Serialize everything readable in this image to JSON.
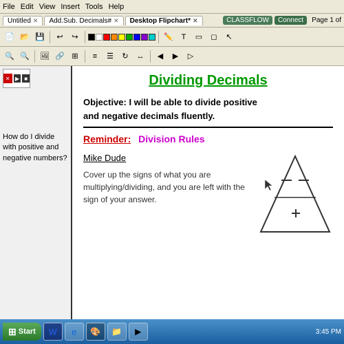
{
  "menubar": {
    "items": [
      "File",
      "Edit",
      "View",
      "Insert",
      "Tools",
      "Help"
    ]
  },
  "tabs": [
    {
      "label": "Untitled",
      "active": false
    },
    {
      "label": "Add.Sub. Decimals#",
      "active": false
    },
    {
      "label": "Desktop Flipchart*",
      "active": true
    }
  ],
  "classflow": {
    "label": "CLASSFLOW",
    "connect": "Connect"
  },
  "page_indicator": "Page 1 of",
  "canvas": {
    "title": "Dividing Decimals",
    "objective_line1": "Objective: I will be able to divide positive",
    "objective_line2": "and negative decimals fluently.",
    "reminder_label": "Reminder:",
    "reminder_text": "Division Rules",
    "mike_dude": "Mike Dude",
    "description": "Cover up the signs of what you are multiplying/dividing, and you are left with the sign of your answer."
  },
  "left_panel": {
    "question": "How do I divide with positive and negative numbers?"
  },
  "taskbar": {
    "start_label": "Start",
    "time": "3:45 PM"
  },
  "colors": {
    "title_green": "#009900",
    "reminder_red": "#cc0000",
    "reminder_purple": "#cc00cc",
    "objective_black": "#000000"
  }
}
